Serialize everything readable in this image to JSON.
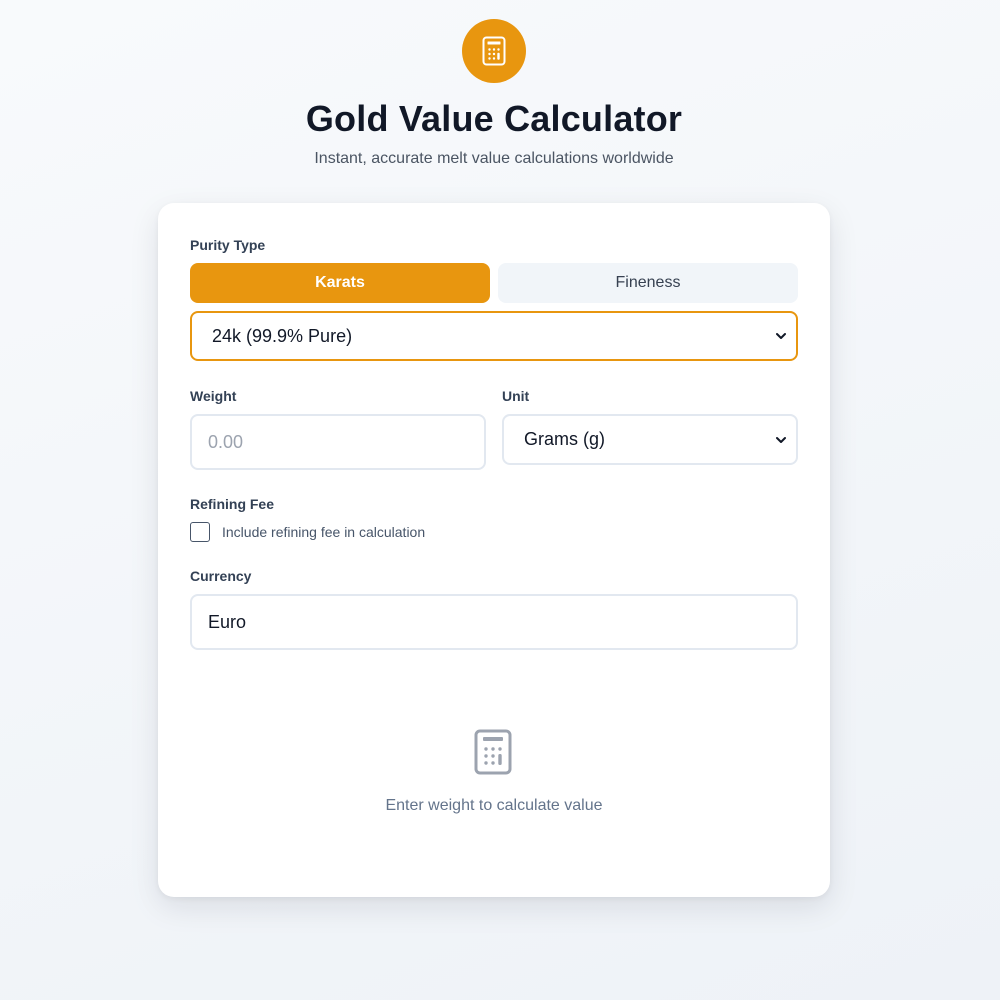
{
  "header": {
    "logo_icon": "calculator-icon",
    "title": "Gold Value Calculator",
    "subtitle": "Instant, accurate melt value calculations worldwide"
  },
  "form": {
    "purity": {
      "label": "Purity Type",
      "tabs": [
        {
          "label": "Karats",
          "active": true
        },
        {
          "label": "Fineness",
          "active": false
        }
      ],
      "selected": "24k (99.9% Pure)"
    },
    "weight": {
      "label": "Weight",
      "value": "",
      "placeholder": "0.00"
    },
    "unit": {
      "label": "Unit",
      "selected": "Grams (g)"
    },
    "refining": {
      "label": "Refining Fee",
      "checkbox_label": "Include refining fee in calculation",
      "checked": false
    },
    "currency": {
      "label": "Currency",
      "value": "Euro"
    }
  },
  "empty_state": {
    "icon": "calculator-icon",
    "message": "Enter weight to calculate value"
  },
  "colors": {
    "accent": "#e8960f",
    "background": "#f4f6f9",
    "card": "#ffffff",
    "muted_text": "#64748b"
  }
}
